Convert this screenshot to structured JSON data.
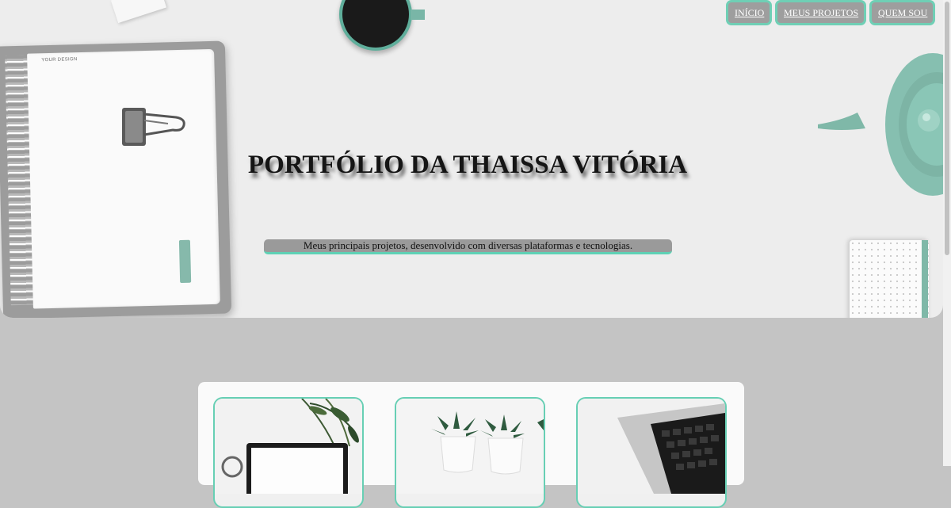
{
  "nav": {
    "items": [
      {
        "label": "INÍCIO"
      },
      {
        "label": "MEUS PROJETOS"
      },
      {
        "label": "QUEM SOU"
      }
    ]
  },
  "hero": {
    "title": "PORTFÓLIO DA THAISSA VITÓRIA",
    "subtitle": "Meus principais projetos, desenvolvido com diversas plataformas e tecnologias.",
    "notebook_label": "YOUR DESIGN"
  },
  "cards": [
    {
      "image": "laptop-plant-photo"
    },
    {
      "image": "succulents-photo"
    },
    {
      "image": "keyboard-laptop-photo"
    }
  ],
  "colors": {
    "accent": "#67cfb4",
    "nav_bg": "#9e9e9e",
    "page_bg": "#c4c4c4",
    "hero_bg": "#ededed"
  }
}
